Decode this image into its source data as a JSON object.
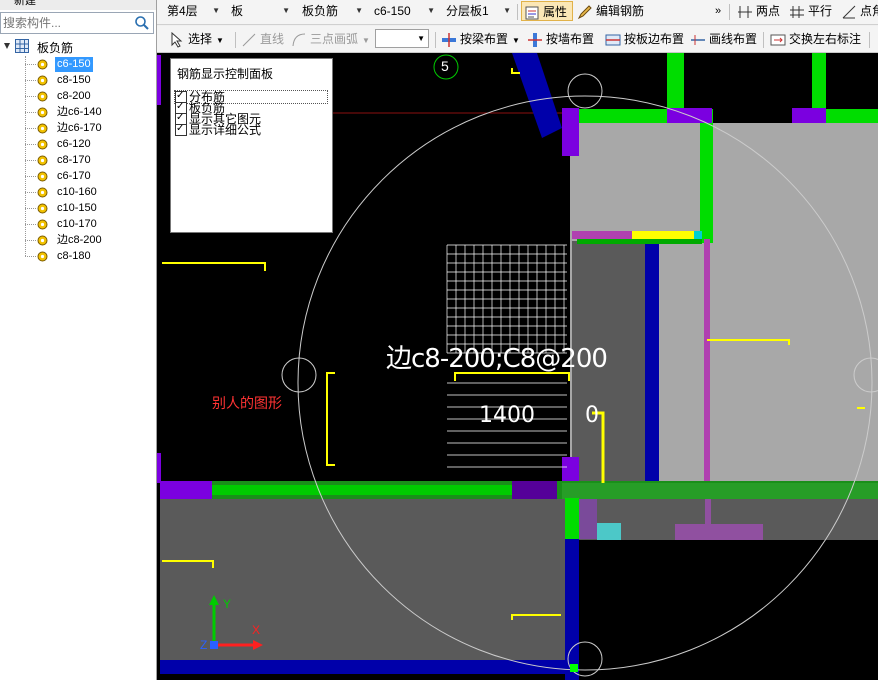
{
  "left_panel": {
    "new_label": "新建",
    "search_placeholder": "搜索构件...",
    "root_label": "板负筋",
    "items": [
      "c6-150",
      "c8-150",
      "c8-200",
      "边c6-140",
      "边c6-170",
      "c6-120",
      "c8-170",
      "c6-170",
      "c10-160",
      "c10-150",
      "c10-170",
      "边c8-200",
      "c8-180"
    ],
    "selected_index": 0
  },
  "toolbar1": {
    "floor": "第4层",
    "type": "板",
    "subtype": "板负筋",
    "spec": "c6-150",
    "layer": "分层板1",
    "attr_label": "属性",
    "edit_label": "编辑钢筋",
    "two_point_label": "两点",
    "parallel_label": "平行",
    "point_label": "点角"
  },
  "toolbar2": {
    "select_label": "选择",
    "line_label": "直线",
    "arc_label": "三点画弧",
    "beam_label": "按梁布置",
    "wall_label": "按墙布置",
    "plate_edge_label": "按板边布置",
    "line_place_label": "画线布置",
    "swap_label": "交换左右标注"
  },
  "control_panel": {
    "title": "钢筋显示控制面板",
    "options": [
      "分布筋",
      "板负筋",
      "显示其它图元",
      "显示详细公式"
    ]
  },
  "canvas": {
    "rebar_label": "边c8-200;C8@200",
    "length_label": "1400",
    "zero_label": "0",
    "axis_number": "5",
    "note": "别人的图形",
    "axis_x": "X",
    "axis_y": "Y",
    "axis_z": "Z"
  },
  "colors": {
    "canvas_bg": "#000000",
    "slab_gray": "#a8a8a8",
    "dark_gray": "#5a5a5a",
    "wall_green": "#00dd00",
    "beam_blue": "#0000aa",
    "column_purple": "#7b00e0",
    "rebar_yellow": "#ffff00",
    "note_red": "#ff3333",
    "selected_bg": "#3399ff"
  }
}
